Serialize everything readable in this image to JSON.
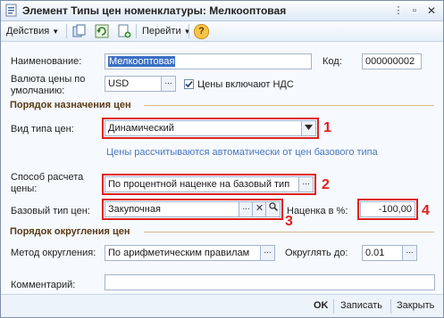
{
  "window": {
    "title": "Элемент Типы цен номенклатуры: Мелкооптовая"
  },
  "toolbar": {
    "actions_label": "Действия",
    "goto_label": "Перейти",
    "help_label": "?"
  },
  "form": {
    "name_label": "Наименование:",
    "name_value": "Мелкооптовая",
    "code_label": "Код:",
    "code_value": "000000002",
    "currency_label": "Валюта цены по умолчанию:",
    "currency_value": "USD",
    "vat_checkbox_label": "Цены включают НДС",
    "vat_checked": true,
    "section_purpose": "Порядок назначения цен",
    "price_kind_label": "Вид типа цен:",
    "price_kind_value": "Динамический",
    "price_kind_hint": "Цены рассчитываются автоматически от цен базового типа",
    "calc_method_label": "Способ расчета цены:",
    "calc_method_value": "По процентной наценке на базовый тип",
    "base_type_label": "Базовый тип цен:",
    "base_type_value": "Закупочная",
    "markup_label": "Наценка в %:",
    "markup_value": "-100,00",
    "section_rounding": "Порядок округления цен",
    "rounding_method_label": "Метод округления:",
    "rounding_method_value": "По арифметическим правилам",
    "round_to_label": "Округлять до:",
    "round_to_value": "0.01",
    "comment_label": "Комментарий:",
    "comment_value": ""
  },
  "annotations": [
    "1",
    "2",
    "3",
    "4"
  ],
  "buttons": {
    "ok": "OK",
    "save": "Записать",
    "close": "Закрыть"
  },
  "icons": {
    "window": "document-list-icon",
    "toolbar": [
      "copy-icon",
      "refresh-icon",
      "new-icon"
    ]
  },
  "colors": {
    "highlight_red": "#e0201c",
    "section_heading": "#5a3a14",
    "hint_blue": "#4a78c0",
    "selection_blue": "#3a6fc4"
  }
}
